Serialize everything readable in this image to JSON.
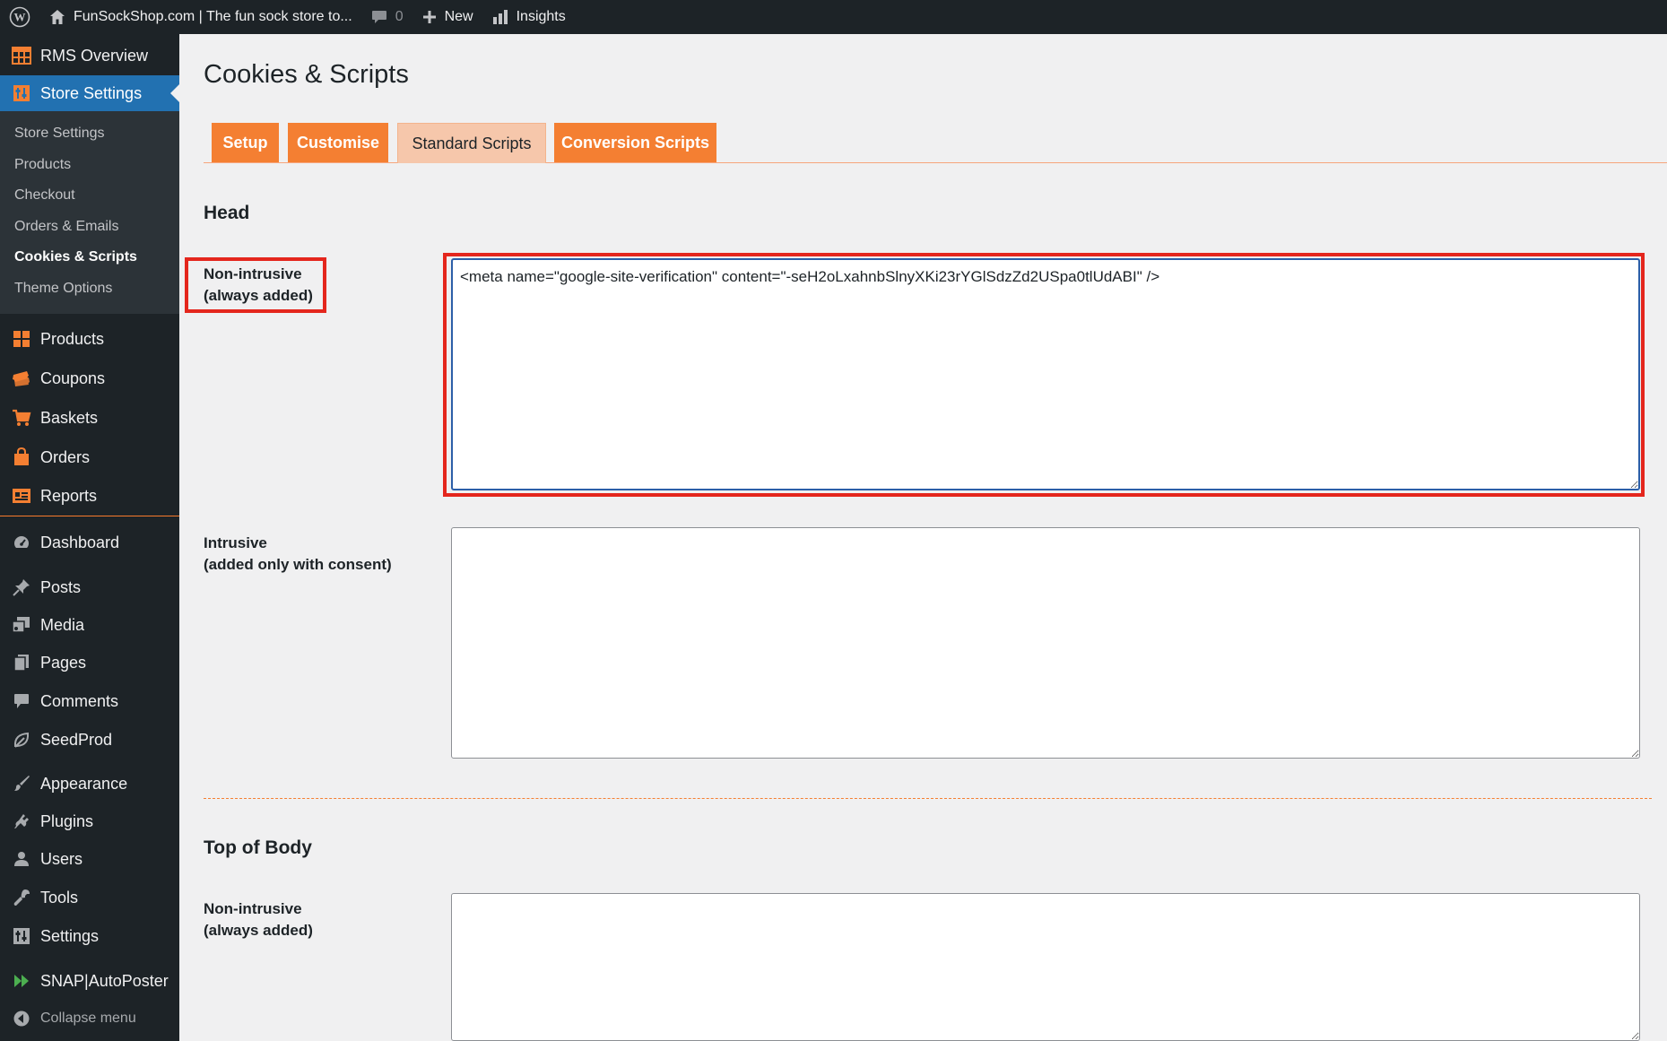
{
  "adminbar": {
    "site_name": "FunSockShop.com | The fun sock store to...",
    "comment_count": "0",
    "new_label": "New",
    "insights_label": "Insights"
  },
  "sidebar": {
    "top_items": [
      {
        "label": "RMS Overview",
        "icon": "table-icon"
      },
      {
        "label": "Store Settings",
        "icon": "settings-grid-icon"
      }
    ],
    "submenu": [
      {
        "label": "Store Settings"
      },
      {
        "label": "Products"
      },
      {
        "label": "Checkout"
      },
      {
        "label": "Orders & Emails"
      },
      {
        "label": "Cookies & Scripts"
      },
      {
        "label": "Theme Options"
      }
    ],
    "store_items": [
      {
        "label": "Products",
        "icon": "grid-icon"
      },
      {
        "label": "Coupons",
        "icon": "coupon-icon"
      },
      {
        "label": "Baskets",
        "icon": "cart-icon"
      },
      {
        "label": "Orders",
        "icon": "bag-icon"
      },
      {
        "label": "Reports",
        "icon": "report-icon"
      }
    ],
    "wp_items": [
      {
        "label": "Dashboard",
        "icon": "dashboard-icon"
      },
      {
        "label": "Posts",
        "icon": "pin-icon"
      },
      {
        "label": "Media",
        "icon": "media-icon"
      },
      {
        "label": "Pages",
        "icon": "pages-icon"
      },
      {
        "label": "Comments",
        "icon": "comment-icon"
      },
      {
        "label": "SeedProd",
        "icon": "leaf-icon"
      },
      {
        "label": "Appearance",
        "icon": "brush-icon"
      },
      {
        "label": "Plugins",
        "icon": "plug-icon"
      },
      {
        "label": "Users",
        "icon": "user-icon"
      },
      {
        "label": "Tools",
        "icon": "wrench-icon"
      },
      {
        "label": "Settings",
        "icon": "settings-icon"
      },
      {
        "label": "SNAP|AutoPoster",
        "icon": "snap-arrow-icon"
      },
      {
        "label": "Collapse menu",
        "icon": "collapse-icon"
      }
    ]
  },
  "main": {
    "title": "Cookies & Scripts",
    "tabs": [
      {
        "label": "Setup"
      },
      {
        "label": "Customise"
      },
      {
        "label": "Standard Scripts"
      },
      {
        "label": "Conversion Scripts"
      }
    ],
    "head_section": {
      "title": "Head",
      "non_intrusive_label_1": "Non-intrusive",
      "non_intrusive_label_2": "(always added)",
      "non_intrusive_value": "<meta name=\"google-site-verification\" content=\"-seH2oLxahnbSlnyXKi23rYGlSdzZd2USpa0tlUdABI\" />",
      "intrusive_label_1": "Intrusive",
      "intrusive_label_2": "(added only with consent)",
      "intrusive_value": ""
    },
    "body_section": {
      "title": "Top of Body",
      "non_intrusive_label_1": "Non-intrusive",
      "non_intrusive_label_2": "(always added)",
      "non_intrusive_value": ""
    }
  },
  "colors": {
    "accent_orange": "#f47f32",
    "wp_blue": "#2271b1",
    "highlight_red": "#e4261d",
    "sidebar_bg": "#1d2327"
  }
}
